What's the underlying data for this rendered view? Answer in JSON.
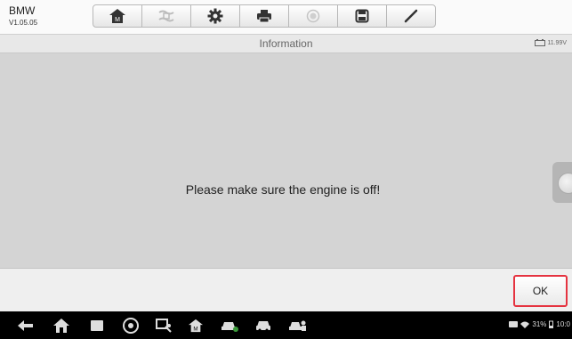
{
  "header": {
    "brand": "BMW",
    "version": "V1.05.05"
  },
  "toolbar": {
    "buttons": [
      "home-icon",
      "vehicle-swap-icon",
      "settings-gear-icon",
      "print-icon",
      "help-icon",
      "save-icon",
      "pen-icon"
    ]
  },
  "titlebar": {
    "title": "Information",
    "battery_voltage": "11.99V"
  },
  "dialog": {
    "message": "Please make sure the engine is off!",
    "ok_label": "OK"
  },
  "navbar": {
    "icons": [
      "back-icon",
      "home-icon",
      "recent-apps-icon",
      "chrome-icon",
      "screen-capture-icon",
      "autel-home-icon",
      "vehicle-icon",
      "car-icon",
      "remote-icon"
    ]
  },
  "status": {
    "battery_percent": "31%",
    "time": "10:0"
  },
  "colors": {
    "ok_border": "#e53340",
    "app_bg": "#d4d4d4"
  }
}
